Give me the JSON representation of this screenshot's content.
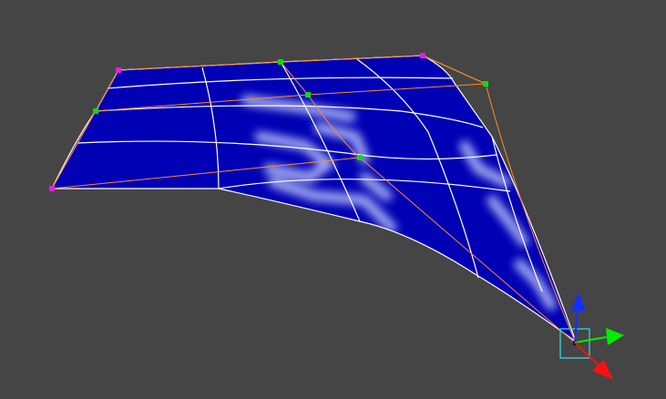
{
  "viewport": {
    "background": "#454545",
    "surface_color": "#0000b4",
    "surface_pattern_color": "#c8d2ff",
    "mesh_line_color": "#ffffff",
    "control_cage_color": "#ff8c28",
    "corner_control_point_color": "#e020e0",
    "mid_control_point_color": "#00e000",
    "gizmo_selection_box_color": "#30d8e0",
    "gizmo_axis_colors": {
      "x": "#ff1010",
      "y": "#00ee00",
      "z": "#1030ff"
    }
  }
}
